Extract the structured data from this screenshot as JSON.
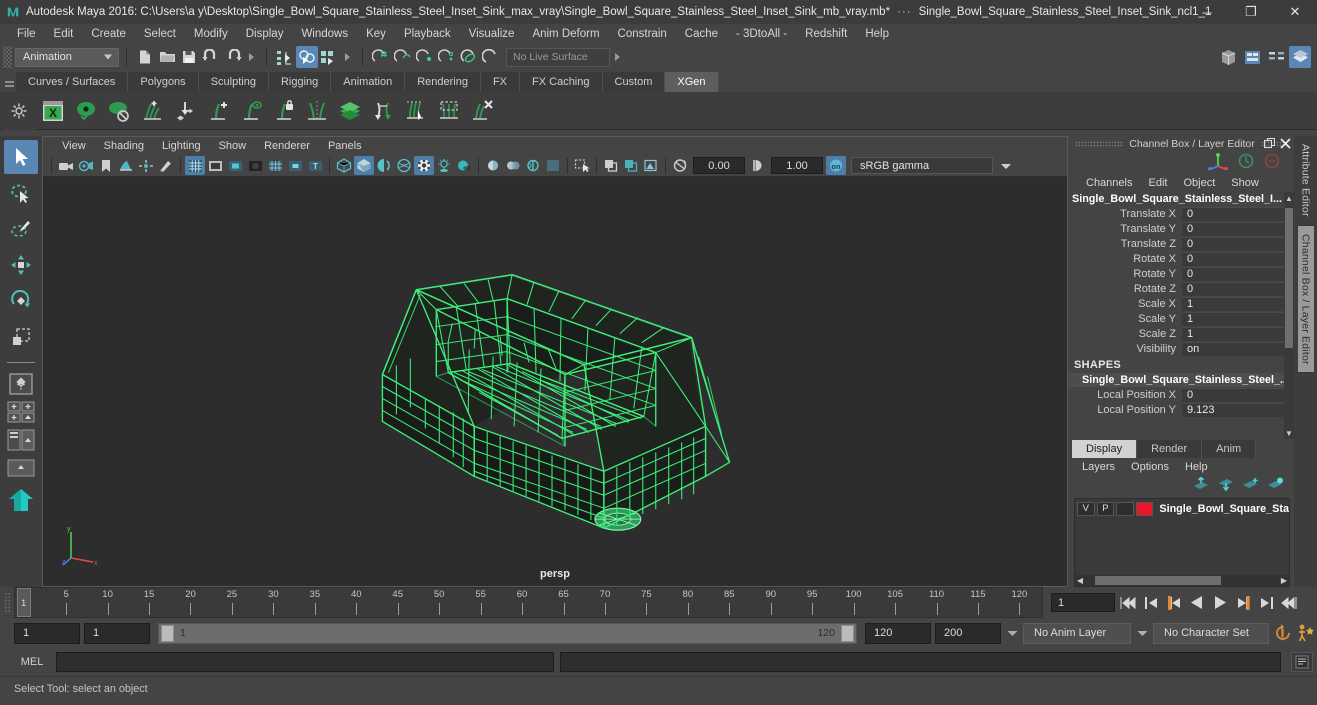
{
  "titlebar": {
    "app_title": "Autodesk Maya 2016: C:\\Users\\a y\\Desktop\\Single_Bowl_Square_Stainless_Steel_Inset_Sink_max_vray\\Single_Bowl_Square_Stainless_Steel_Inset_Sink_mb_vray.mb*",
    "separator": "···",
    "node_name": "Single_Bowl_Square_Stainless_Steel_Inset_Sink_ncl1_1",
    "minimize": "─",
    "maximize": "❐",
    "close": "✕"
  },
  "menubar": {
    "items": [
      {
        "label": "File"
      },
      {
        "label": "Edit"
      },
      {
        "label": "Create"
      },
      {
        "label": "Select"
      },
      {
        "label": "Modify"
      },
      {
        "label": "Display"
      },
      {
        "label": "Windows"
      },
      {
        "label": "Key"
      },
      {
        "label": "Playback"
      },
      {
        "label": "Visualize"
      },
      {
        "label": "Anim Deform"
      },
      {
        "label": "Constrain"
      },
      {
        "label": "Cache"
      },
      {
        "label": "- 3DtoAll -"
      },
      {
        "label": "Redshift"
      },
      {
        "label": "Help"
      }
    ]
  },
  "statusline": {
    "menuset": "Animation",
    "live_surface": "No Live Surface"
  },
  "shelf_tabs": {
    "items": [
      {
        "label": "Curves / Surfaces",
        "active": false
      },
      {
        "label": "Polygons",
        "active": false
      },
      {
        "label": "Sculpting",
        "active": false
      },
      {
        "label": "Rigging",
        "active": false
      },
      {
        "label": "Animation",
        "active": false
      },
      {
        "label": "Rendering",
        "active": false
      },
      {
        "label": "FX",
        "active": false
      },
      {
        "label": "FX Caching",
        "active": false
      },
      {
        "label": "Custom",
        "active": false
      },
      {
        "label": "XGen",
        "active": true
      }
    ]
  },
  "shelf_icons": [
    "xgen-window-icon",
    "xgen-preview-icon",
    "xgen-preview-off-icon",
    "xgen-add-description-icon",
    "xgen-place-icon",
    "xgen-add-guide-icon",
    "xgen-guide-preview-icon",
    "xgen-lock-guide-icon",
    "xgen-mirror-guide-icon",
    "xgen-layers-icon",
    "xgen-flip-icon",
    "xgen-select-guide-icon",
    "xgen-region-icon",
    "xgen-delete-guide-icon"
  ],
  "toolbox": {
    "tools": [
      {
        "name": "select-tool",
        "active": true
      },
      {
        "name": "lasso-select-tool",
        "active": false
      },
      {
        "name": "paint-select-tool",
        "active": false
      },
      {
        "name": "move-tool",
        "active": false
      },
      {
        "name": "rotate-tool",
        "active": false
      },
      {
        "name": "scale-tool",
        "active": false
      }
    ],
    "layout_buttons": [
      "single-perspective-layout",
      "four-view-layout",
      "two-pane-side-layout",
      "outliner-persp-layout",
      "persp-graph-layout",
      "hypershade-layout"
    ]
  },
  "viewport": {
    "menus": [
      {
        "label": "View"
      },
      {
        "label": "Shading"
      },
      {
        "label": "Lighting"
      },
      {
        "label": "Show"
      },
      {
        "label": "Renderer"
      },
      {
        "label": "Panels"
      }
    ],
    "exposure_value": "0.00",
    "gamma_value": "1.00",
    "color_management": "sRGB gamma",
    "camera_label": "persp",
    "wireframe_color": "#3cf07a",
    "background_color": "#2d2d2d"
  },
  "channel_box": {
    "panel_title": "Channel Box / Layer Editor",
    "menus": [
      {
        "label": "Channels"
      },
      {
        "label": "Edit"
      },
      {
        "label": "Object"
      },
      {
        "label": "Show"
      }
    ],
    "object_name": "Single_Bowl_Square_Stainless_Steel_I...",
    "attributes": [
      {
        "label": "Translate X",
        "value": "0"
      },
      {
        "label": "Translate Y",
        "value": "0"
      },
      {
        "label": "Translate Z",
        "value": "0"
      },
      {
        "label": "Rotate X",
        "value": "0"
      },
      {
        "label": "Rotate Y",
        "value": "0"
      },
      {
        "label": "Rotate Z",
        "value": "0"
      },
      {
        "label": "Scale X",
        "value": "1"
      },
      {
        "label": "Scale Y",
        "value": "1"
      },
      {
        "label": "Scale Z",
        "value": "1"
      },
      {
        "label": "Visibility",
        "value": "on"
      }
    ],
    "shapes_header": "SHAPES",
    "shape_name": "Single_Bowl_Square_Stainless_Steel_...",
    "shape_attributes": [
      {
        "label": "Local Position X",
        "value": "0"
      },
      {
        "label": "Local Position Y",
        "value": "9.123"
      }
    ],
    "vertical_tabs": [
      {
        "label": "Attribute Editor",
        "selected": false
      },
      {
        "label": "Channel Box / Layer Editor",
        "selected": true
      }
    ]
  },
  "layer_editor": {
    "tabs": [
      {
        "label": "Display",
        "active": true
      },
      {
        "label": "Render",
        "active": false
      },
      {
        "label": "Anim",
        "active": false
      }
    ],
    "menus": [
      {
        "label": "Layers"
      },
      {
        "label": "Options"
      },
      {
        "label": "Help"
      }
    ],
    "icons": [
      "move-layer-up-icon",
      "move-layer-down-icon",
      "new-layer-icon",
      "new-layer-from-selected-icon"
    ],
    "layers": [
      {
        "visibility": "V",
        "playback": "P",
        "shading": "",
        "color": "#e8172b",
        "name": "Single_Bowl_Square_Sta"
      }
    ]
  },
  "timeline": {
    "ticks": [
      5,
      10,
      15,
      20,
      25,
      30,
      35,
      40,
      45,
      50,
      55,
      60,
      65,
      70,
      75,
      80,
      85,
      90,
      95,
      100,
      105,
      110,
      115,
      120
    ],
    "current_frame_marker": "1",
    "current_frame_field": "1",
    "playback_buttons": [
      "go-to-start-icon",
      "step-back-keyframe-icon",
      "step-back-frame-icon",
      "play-backwards-icon",
      "play-forwards-icon",
      "step-forward-frame-icon",
      "step-forward-keyframe-icon",
      "go-to-end-icon"
    ]
  },
  "range_slider": {
    "anim_start": "1",
    "range_start": "1",
    "bar_start_label": "1",
    "bar_end_label": "120",
    "range_end": "120",
    "anim_end": "200",
    "anim_layer": "No Anim Layer",
    "character_set": "No Character Set",
    "auto_keyframe_icon": "auto-keyframe-icon",
    "anim_prefs_icon": "animation-preferences-icon"
  },
  "command_line": {
    "label": "MEL",
    "input_value": "",
    "output_value": "",
    "script_editor_icon": "script-editor-icon"
  },
  "status_bar": {
    "message": "Select Tool: select an object"
  }
}
